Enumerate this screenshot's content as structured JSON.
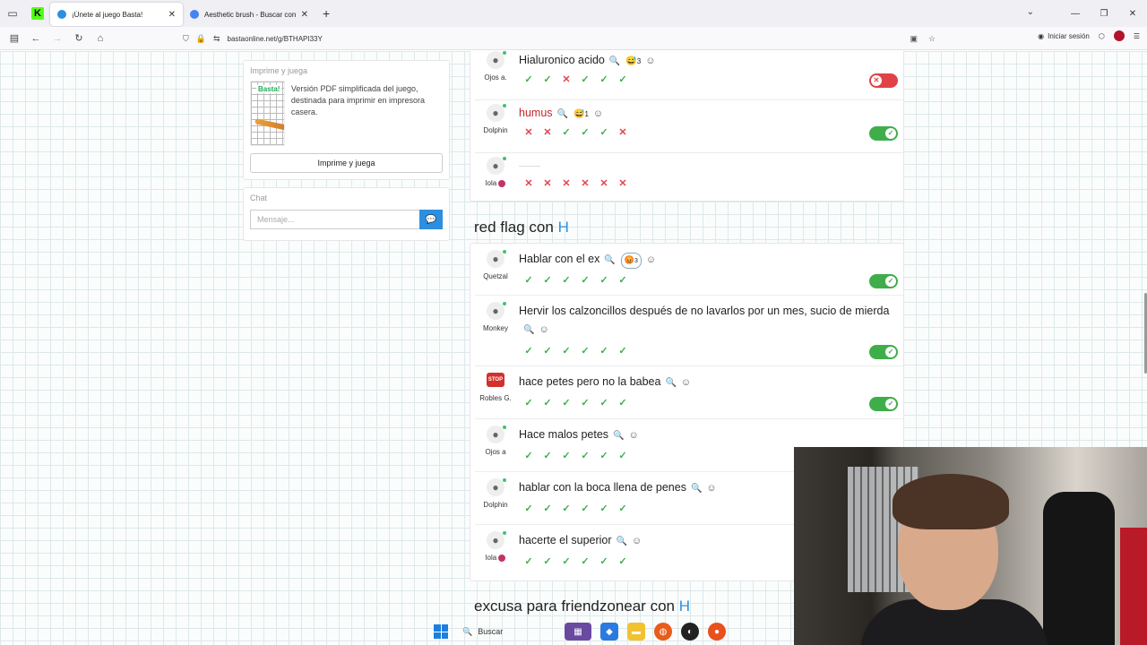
{
  "browser": {
    "tabs": [
      {
        "title": "¡Únete al juego Basta!",
        "active": true,
        "favicon_color": "#2d8fe0"
      },
      {
        "title": "Aesthetic brush - Buscar con Go",
        "active": false,
        "favicon_color": "#4285f4"
      }
    ],
    "url": "bastaonline.net/g/BTHAPI33Y",
    "signin_label": "Iniciar sesión"
  },
  "sidebar": {
    "print_card": {
      "title": "Imprime y juega",
      "description": "Versión PDF simplificada del juego, destinada para imprimir en impresora casera.",
      "image_logo": "Basta!",
      "button_label": "Imprime y juega"
    },
    "chat": {
      "title": "Chat",
      "placeholder": "Mensaje..."
    }
  },
  "top_answers": [
    {
      "word": "Hialuronico acido",
      "user": "Ojos a.",
      "reaction": "😅",
      "reaction_count": "3",
      "votes": [
        "ok",
        "ok",
        "no",
        "ok",
        "ok",
        "ok"
      ],
      "accepted": false,
      "word_color": "normal"
    },
    {
      "word": "humus",
      "user": "Dolphin",
      "reaction": "😅",
      "reaction_count": "1",
      "votes": [
        "no",
        "no",
        "ok",
        "ok",
        "ok",
        "no"
      ],
      "accepted": true,
      "word_color": "red"
    },
    {
      "word": "",
      "user": "lola",
      "votes": [
        "no",
        "no",
        "no",
        "no",
        "no",
        "no"
      ],
      "accepted": null
    }
  ],
  "section_red_flag": {
    "title": "red flag con",
    "letter": "H",
    "answers": [
      {
        "word": "Hablar con el ex",
        "user": "Quetzal",
        "reaction": "😡",
        "reaction_count": "3",
        "votes": [
          "ok",
          "ok",
          "ok",
          "ok",
          "ok",
          "ok"
        ],
        "accepted": true
      },
      {
        "word": "Hervir los calzoncillos después de no lavarlos por un mes, sucio de mierda",
        "user": "Monkey",
        "votes": [
          "ok",
          "ok",
          "ok",
          "ok",
          "ok",
          "ok"
        ],
        "accepted": true
      },
      {
        "word": "hace petes pero no la babea",
        "user": "Robles G.",
        "avatar_badge": "STOP",
        "votes": [
          "ok",
          "ok",
          "ok",
          "ok",
          "ok",
          "ok"
        ],
        "accepted": true
      },
      {
        "word": "Hace malos petes",
        "user": "Ojos a",
        "votes": [
          "ok",
          "ok",
          "ok",
          "ok",
          "ok",
          "ok"
        ],
        "accepted": null
      },
      {
        "word": "hablar con la boca llena de penes",
        "user": "Dolphin",
        "votes": [
          "ok",
          "ok",
          "ok",
          "ok",
          "ok",
          "ok"
        ],
        "accepted": null
      },
      {
        "word": "hacerte el superior",
        "user": "lola",
        "votes": [
          "ok",
          "ok",
          "ok",
          "ok",
          "ok",
          "ok"
        ],
        "accepted": null
      }
    ]
  },
  "section_friendzone": {
    "title": "excusa para friendzonear con",
    "letter": "H"
  },
  "taskbar": {
    "search_label": "Buscar"
  }
}
